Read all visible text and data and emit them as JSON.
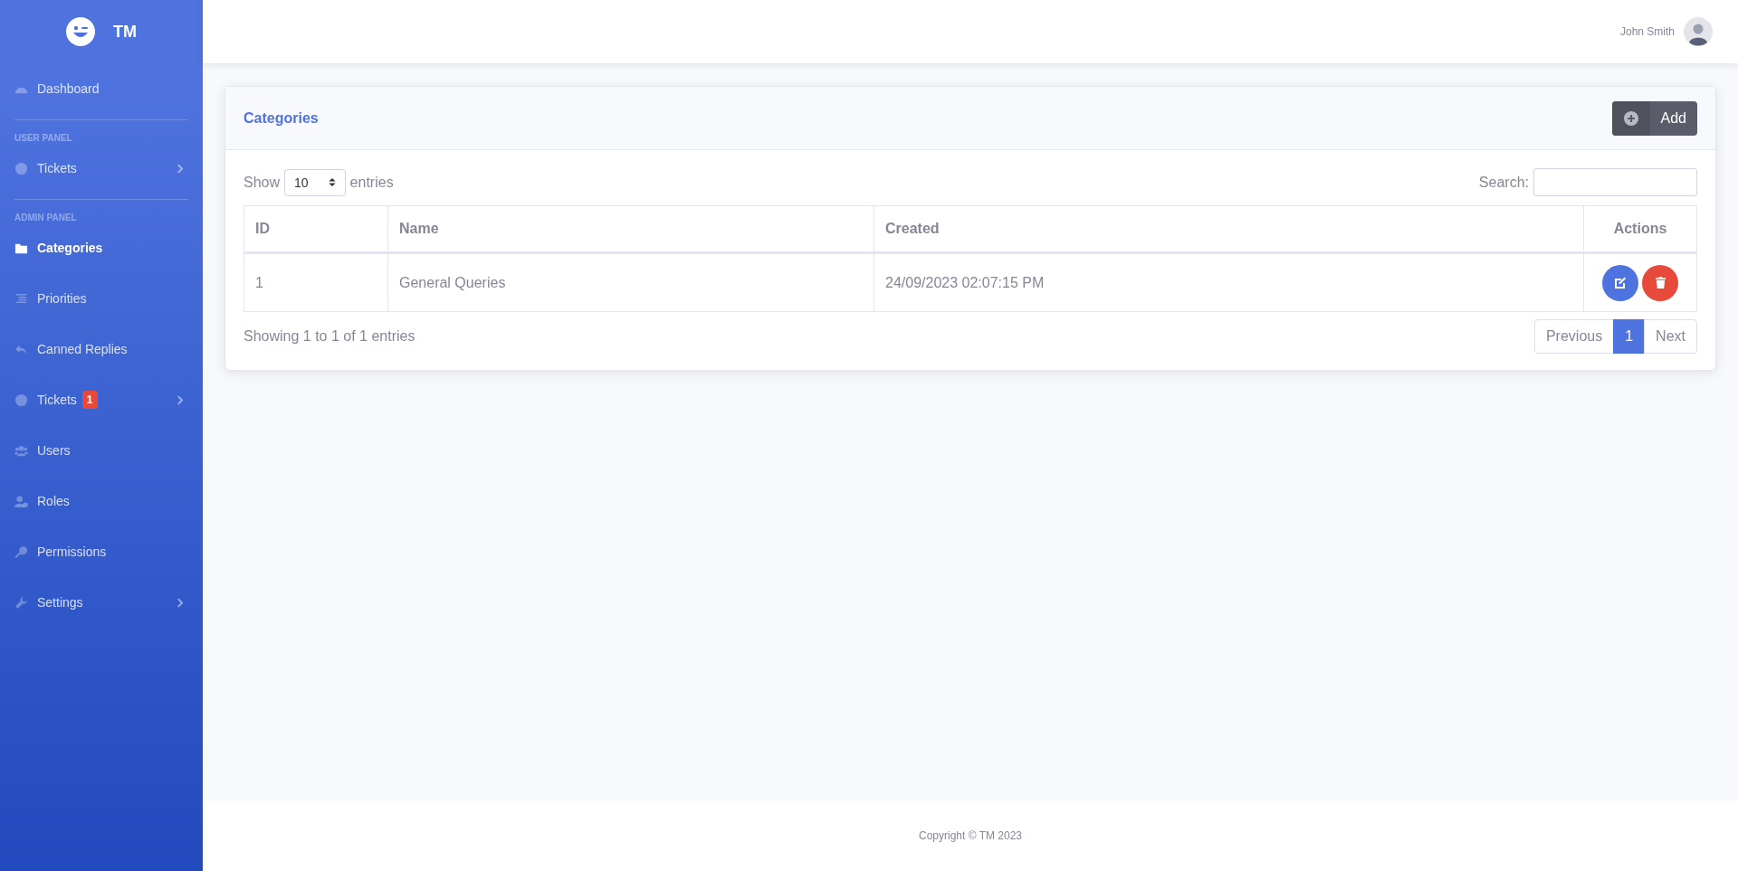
{
  "brand": {
    "name": "TM"
  },
  "sidebar": {
    "sections": [
      {
        "items": [
          {
            "label": "Dashboard",
            "selected": false,
            "expandable": false
          }
        ]
      },
      {
        "heading": "USER PANEL",
        "items": [
          {
            "label": "Tickets",
            "selected": false,
            "expandable": true
          }
        ]
      },
      {
        "heading": "ADMIN PANEL",
        "items": [
          {
            "label": "Categories",
            "selected": true,
            "expandable": false
          },
          {
            "label": "Priorities",
            "selected": false,
            "expandable": false
          },
          {
            "label": "Canned Replies",
            "selected": false,
            "expandable": false
          },
          {
            "label": "Tickets",
            "selected": false,
            "expandable": true,
            "badge": "1"
          },
          {
            "label": "Users",
            "selected": false,
            "expandable": false
          },
          {
            "label": "Roles",
            "selected": false,
            "expandable": false
          },
          {
            "label": "Permissions",
            "selected": false,
            "expandable": false
          },
          {
            "label": "Settings",
            "selected": false,
            "expandable": true
          }
        ]
      }
    ]
  },
  "topbar": {
    "user_name": "John Smith"
  },
  "card": {
    "title": "Categories",
    "add_button": "Add",
    "length": {
      "show": "Show",
      "value": "10",
      "entries": "entries"
    },
    "search": {
      "label": "Search:"
    },
    "table": {
      "columns": [
        "ID",
        "Name",
        "Created",
        "Actions"
      ],
      "rows": [
        {
          "id": "1",
          "name": "General Queries",
          "created": "24/09/2023 02:07:15 PM"
        }
      ]
    },
    "info": "Showing 1 to 1 of 1 entries",
    "pagination": {
      "previous": "Previous",
      "pages": [
        {
          "label": "1",
          "selected": true
        }
      ],
      "next": "Next"
    }
  },
  "footer": "Copyright © TM 2023"
}
